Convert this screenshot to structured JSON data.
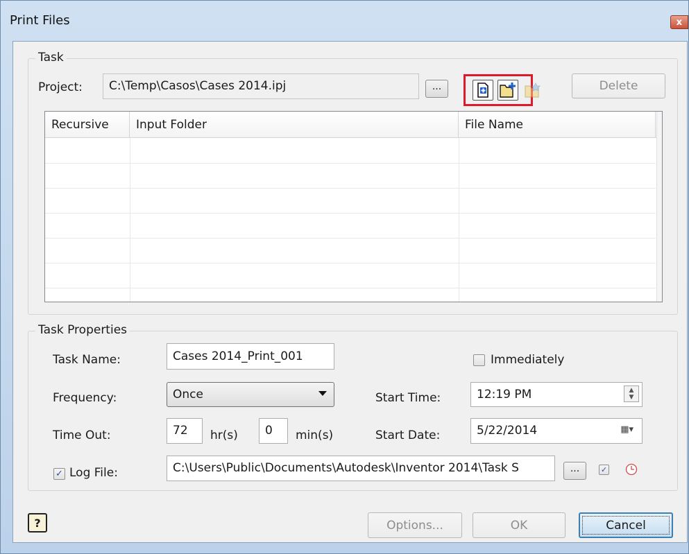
{
  "window": {
    "title": "Print Files",
    "close_glyph": "x"
  },
  "task": {
    "legend": "Task",
    "project_label": "Project:",
    "project_path": "C:\\Temp\\Casos\\Cases 2014.ipj",
    "browse_label": "...",
    "delete_label": "Delete",
    "icons": [
      "add-file-icon",
      "add-folder-icon",
      "import-icon"
    ],
    "columns": [
      "Recursive",
      "Input Folder",
      "File Name"
    ],
    "rows": []
  },
  "properties": {
    "legend": "Task Properties",
    "task_name_label": "Task Name:",
    "task_name_value": "Cases 2014_Print_001",
    "immediately_label": "Immediately",
    "immediately_checked": false,
    "frequency_label": "Frequency:",
    "frequency_value": "Once",
    "start_time_label": "Start Time:",
    "start_time_value": "12:19 PM",
    "timeout_label": "Time Out:",
    "timeout_hours": "72",
    "hours_unit": "hr(s)",
    "timeout_minutes": "0",
    "minutes_unit": "min(s)",
    "start_date_label": "Start Date:",
    "start_date_value": "5/22/2014",
    "log_file_label": "Log File:",
    "log_file_checked": true,
    "log_file_path": "C:\\Users\\Public\\Documents\\Autodesk\\Inventor 2014\\Task S",
    "log_browse_label": "..."
  },
  "footer": {
    "help_glyph": "?",
    "options_label": "Options...",
    "ok_label": "OK",
    "cancel_label": "Cancel"
  },
  "colors": {
    "highlight": "#e0192a",
    "title_gradient": "#cfe0f2",
    "dialog_bg": "#f0f0f0"
  }
}
